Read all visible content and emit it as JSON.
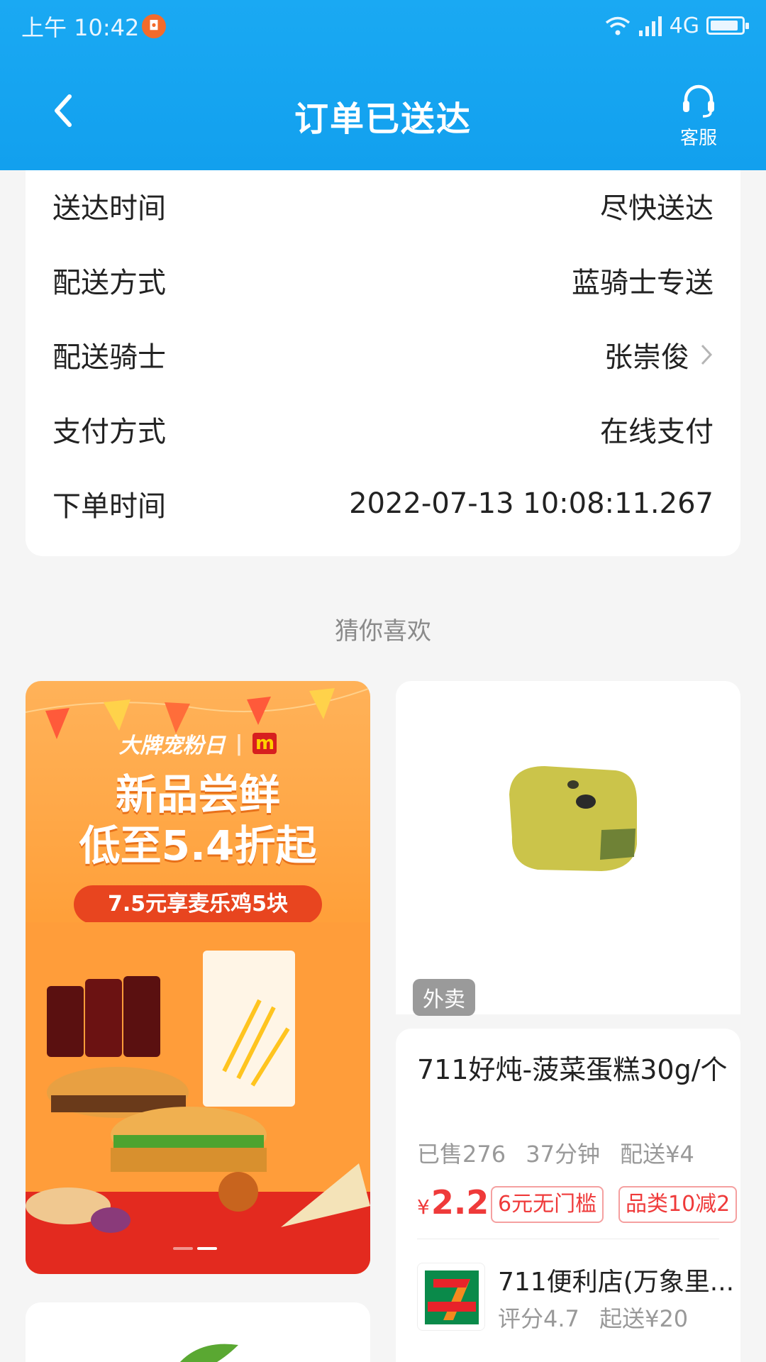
{
  "status_bar": {
    "time": "上午 10:42",
    "notif_glyph": "◘",
    "network": "4G",
    "battery_level": 0.9
  },
  "header": {
    "title": "订单已送达",
    "service_label": "客服"
  },
  "order_info": [
    {
      "label": "送达时间",
      "value": "尽快送达",
      "link": false
    },
    {
      "label": "配送方式",
      "value": "蓝骑士专送",
      "link": false
    },
    {
      "label": "配送骑士",
      "value": "张崇俊",
      "link": true
    },
    {
      "label": "支付方式",
      "value": "在线支付",
      "link": false
    },
    {
      "label": "下单时间",
      "value": "2022-07-13 10:08:11.267",
      "link": false
    }
  ],
  "recommend_title": "猜你喜欢",
  "banner": {
    "brand": "大牌宠粉日",
    "m_logo": "m",
    "headline_1": "新品尝鲜",
    "headline_2": "低至5.4折起",
    "promo": "7.5元享麦乐鸡5块",
    "carousel_index": 1,
    "carousel_count": 2
  },
  "product": {
    "tag": "外卖",
    "name": "711好炖-菠菜蛋糕30g/个",
    "sold": "已售276",
    "time": "37分钟",
    "delivery": "配送¥4",
    "price_currency": "¥",
    "price": "2.2",
    "coupons": [
      "6元无门槛",
      "品类10减2"
    ],
    "store_name": "711便利店(万象里...",
    "store_rating": "评分4.7",
    "store_min": "起送¥20"
  },
  "colors": {
    "header": "#12a0ee",
    "price": "#ef3a3a",
    "banner": "#ff8a1f"
  }
}
